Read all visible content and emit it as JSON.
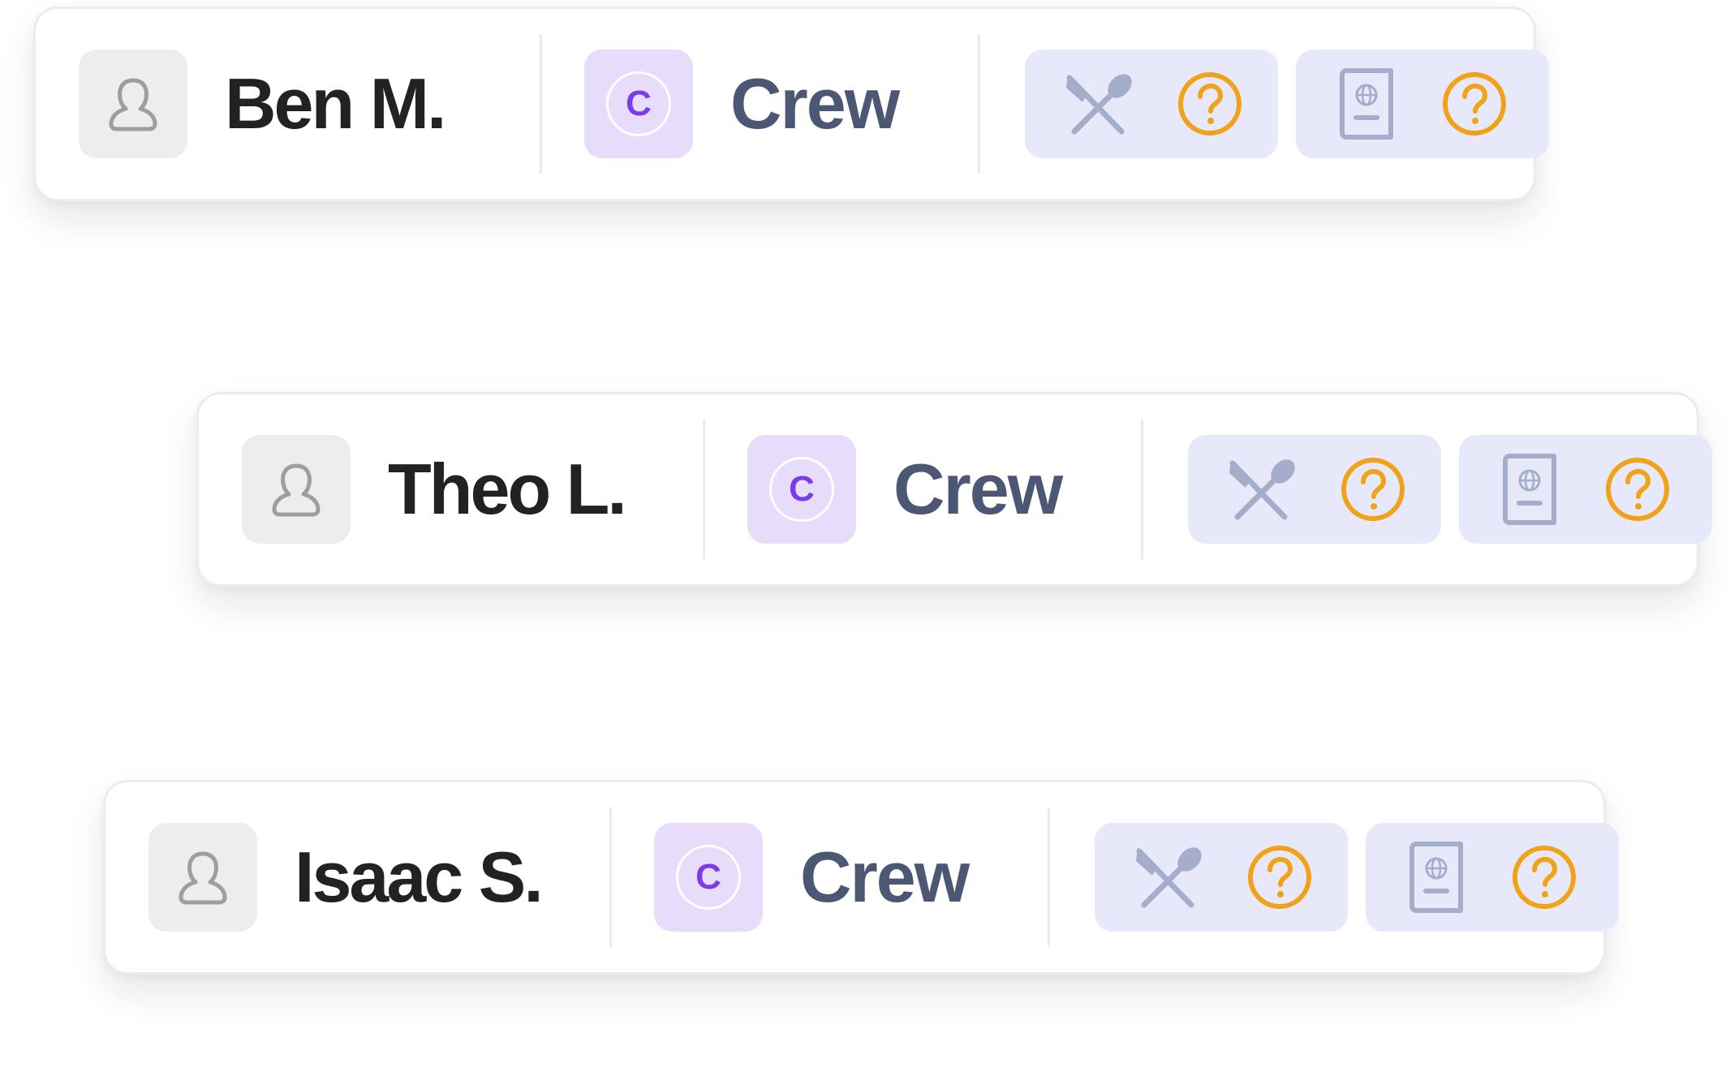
{
  "rows": [
    {
      "name": "Ben M.",
      "role": {
        "label": "Crew",
        "initial": "C"
      },
      "dietary": {
        "icon": "utensils-icon",
        "status_icon": "question-circle-icon"
      },
      "passport": {
        "icon": "passport-icon",
        "status_icon": "question-circle-icon"
      }
    },
    {
      "name": "Theo L.",
      "role": {
        "label": "Crew",
        "initial": "C"
      },
      "dietary": {
        "icon": "utensils-icon",
        "status_icon": "question-circle-icon"
      },
      "passport": {
        "icon": "passport-icon",
        "status_icon": "question-circle-icon"
      }
    },
    {
      "name": "Isaac S.",
      "role": {
        "label": "Crew",
        "initial": "C"
      },
      "dietary": {
        "icon": "utensils-icon",
        "status_icon": "question-circle-icon"
      },
      "passport": {
        "icon": "passport-icon",
        "status_icon": "question-circle-icon"
      }
    }
  ],
  "colors": {
    "name_text": "#222222",
    "role_text": "#4c5774",
    "role_badge_bg": "#e8dcfb",
    "role_initial": "#7c3aed",
    "pill_bg": "#e8e8fb",
    "pill_icon": "#a4aecb",
    "warning": "#f0a318",
    "avatar_bg": "#ededed"
  }
}
